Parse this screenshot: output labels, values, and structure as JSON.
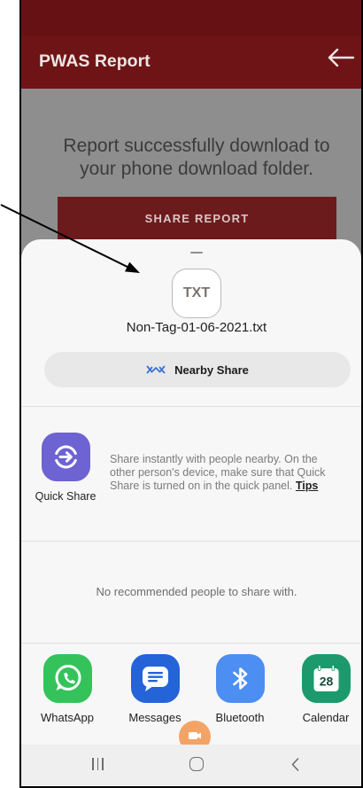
{
  "app_bar": {
    "title": "PWAS Report",
    "back_icon": "arrow-left-icon"
  },
  "main": {
    "message_lines": [
      "Report successfully download to",
      "your phone download folder."
    ],
    "share_button_label": "SHARE REPORT"
  },
  "share_sheet": {
    "handle_icon": "drag-handle-icon",
    "file": {
      "type_label": "TXT",
      "name": "Non-Tag-01-06-2021.txt"
    },
    "nearby_share": {
      "icon": "nearby-share-icon",
      "label": "Nearby Share"
    },
    "quick_share": {
      "icon": "quick-share-icon",
      "label": "Quick Share",
      "description": "Share instantly with people nearby. On the other person's device, make sure that Quick Share is turned on in the quick panel.",
      "tips_link": "Tips"
    },
    "recommended_people": {
      "empty_message": "No recommended people to share with."
    },
    "apps": [
      {
        "label": "WhatsApp",
        "icon": "whatsapp-icon",
        "color": "#34c35a"
      },
      {
        "label": "Messages",
        "icon": "messages-icon",
        "color": "#2463d8"
      },
      {
        "label": "Bluetooth",
        "icon": "bluetooth-icon",
        "color": "#4c8ef2"
      },
      {
        "label": "Calendar",
        "icon": "calendar-icon",
        "color": "#1c9a6d",
        "day": "28"
      }
    ],
    "partial_app": {
      "icon": "video-app-icon",
      "color": "#f4a366"
    }
  },
  "nav_bar": {
    "icons": [
      "recent-apps-icon",
      "home-icon",
      "back-icon"
    ]
  },
  "colors": {
    "status_bar": "#661214",
    "app_bar": "#6e1416",
    "dim_overlay": "#8e8e8e",
    "share_button": "#6c1b1d",
    "sheet": "#f7f7f7",
    "nav_bar": "#efefef",
    "nearby_accent": "#3a74d8",
    "quick_share": "#6e63d2",
    "annotation": "#000000"
  }
}
